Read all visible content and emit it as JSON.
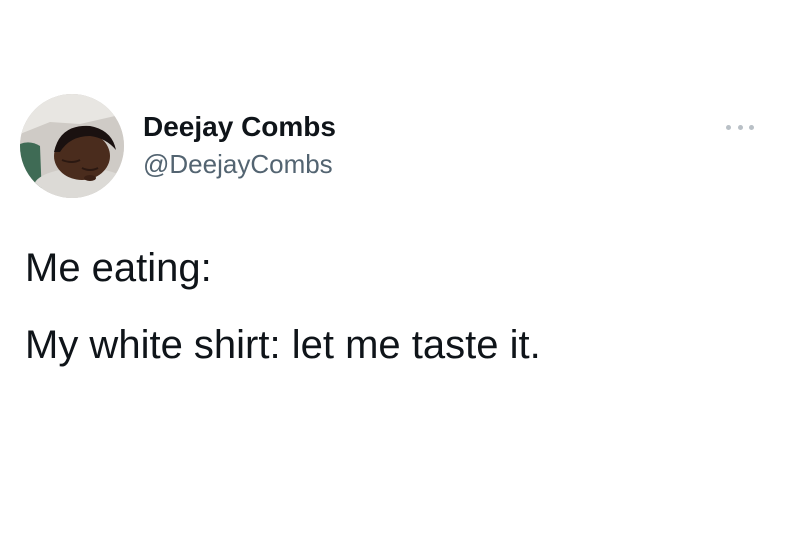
{
  "author": {
    "display_name": "Deejay Combs",
    "handle": "@DeejayCombs"
  },
  "avatar": {
    "icon": "profile-photo"
  },
  "menu": {
    "icon": "more-horizontal-icon"
  },
  "tweet": {
    "lines": [
      "Me eating:",
      "My white shirt: let me taste it."
    ]
  },
  "colors": {
    "text": "#0f1419",
    "secondary_text": "#536471",
    "menu_dots": "#b9c0c6",
    "background": "#ffffff"
  }
}
